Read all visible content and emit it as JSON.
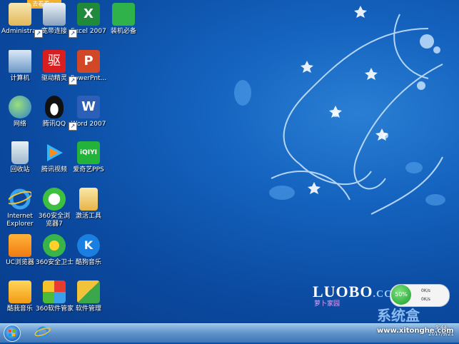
{
  "desktop": {
    "promo_tag": "去看看 >",
    "icons": [
      {
        "label": "Administra...",
        "name": "desktop-icon-administrator"
      },
      {
        "label": "宽带连接",
        "name": "desktop-icon-broadband"
      },
      {
        "label": "Excel 2007",
        "name": "desktop-icon-excel"
      },
      {
        "label": "装机必备",
        "name": "desktop-icon-install-essentials"
      },
      {
        "label": "计算机",
        "name": "desktop-icon-computer"
      },
      {
        "label": "驱动精灵",
        "name": "desktop-icon-driver-genius"
      },
      {
        "label": "PowerPnt...",
        "name": "desktop-icon-powerpoint"
      },
      {
        "label": "网络",
        "name": "desktop-icon-network"
      },
      {
        "label": "腾讯QQ",
        "name": "desktop-icon-qq"
      },
      {
        "label": "Word 2007",
        "name": "desktop-icon-word"
      },
      {
        "label": "回收站",
        "name": "desktop-icon-recycle-bin"
      },
      {
        "label": "腾讯视频",
        "name": "desktop-icon-tencent-video"
      },
      {
        "label": "爱奇艺PPS",
        "name": "desktop-icon-iqiyi"
      },
      {
        "label": "Internet Explorer",
        "name": "desktop-icon-ie"
      },
      {
        "label": "360安全浏览器7",
        "name": "desktop-icon-360-browser"
      },
      {
        "label": "激活工具",
        "name": "desktop-icon-activation-tool"
      },
      {
        "label": "UC浏览器",
        "name": "desktop-icon-uc-browser"
      },
      {
        "label": "360安全卫士",
        "name": "desktop-icon-360-guard"
      },
      {
        "label": "酷狗音乐",
        "name": "desktop-icon-kugou"
      },
      {
        "label": "酷我音乐",
        "name": "desktop-icon-kuwo"
      },
      {
        "label": "360软件管家",
        "name": "desktop-icon-360-software"
      },
      {
        "label": "软件管理",
        "name": "desktop-icon-software-manager"
      }
    ],
    "logo": "LUOBO",
    "logo_suffix": ".CC",
    "logo_sub": "萝卜家园",
    "watermark": "系统盒",
    "net_widget": {
      "percent": "50%",
      "up": "0K/s",
      "down": "0K/s"
    }
  },
  "taskbar": {
    "clock_time": "9:44",
    "clock_date": "2017/9/21",
    "watermark_url": "www.xitonghe.com"
  }
}
